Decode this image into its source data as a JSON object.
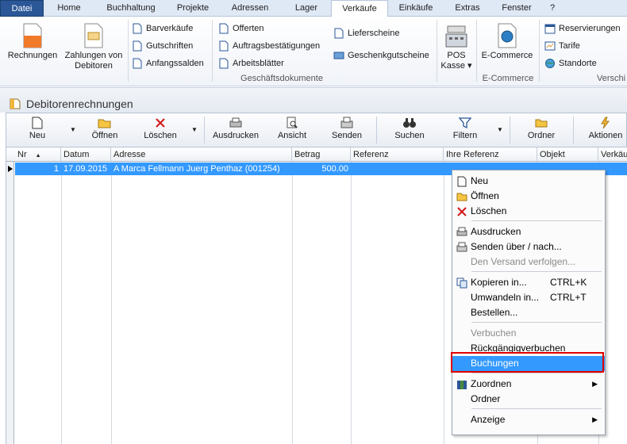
{
  "menubar": {
    "items": [
      "Datei",
      "Home",
      "Buchhaltung",
      "Projekte",
      "Adressen",
      "Lager",
      "Verkäufe",
      "Einkäufe",
      "Extras",
      "Fenster",
      "?"
    ]
  },
  "ribbon": {
    "rechnungen": "Rechnungen",
    "zahlungen_1": "Zahlungen von",
    "zahlungen_2": "Debitoren",
    "barverkaeufe": "Barverkäufe",
    "gutschriften": "Gutschriften",
    "anfangssalden": "Anfangssalden",
    "offerten": "Offerten",
    "auftragsbestaetigungen": "Auftragsbestätigungen",
    "arbeitsblaetter": "Arbeitsblätter",
    "lieferscheine": "Lieferscheine",
    "geschenkgutscheine": "Geschenkgutscheine",
    "pos_1": "POS",
    "pos_2": "Kasse ▾",
    "ecommerce": "E-Commerce",
    "reservierungen": "Reservierungen",
    "tarife": "Tarife",
    "standorte": "Standorte",
    "group_geschaeft": "Geschäftsdokumente",
    "group_ecommerce": "E-Commerce",
    "group_versch": "Verschi"
  },
  "window": {
    "title": "Debitorenrechnungen"
  },
  "toolbar": {
    "neu": "Neu",
    "oeffnen": "Öffnen",
    "loeschen": "Löschen",
    "ausdrucken": "Ausdrucken",
    "ansicht": "Ansicht",
    "senden": "Senden",
    "suchen": "Suchen",
    "filtern": "Filtern",
    "ordner": "Ordner",
    "aktionen": "Aktionen"
  },
  "grid": {
    "headers": [
      "Nr",
      "Datum",
      "Adresse",
      "Betrag",
      "Referenz",
      "Ihre Referenz",
      "Objekt",
      "Verkäu"
    ],
    "rows": [
      {
        "nr": "1",
        "datum": "17.09.2015",
        "adresse": "A Marca Fellmann Juerg Penthaz (001254)",
        "betrag": "500.00"
      }
    ]
  },
  "context_menu": {
    "neu": "Neu",
    "oeffnen": "Öffnen",
    "loeschen": "Löschen",
    "ausdrucken": "Ausdrucken",
    "senden": "Senden über / nach...",
    "versand": "Den Versand verfolgen...",
    "kopieren": "Kopieren in...",
    "kopieren_sc": "CTRL+K",
    "umwandeln": "Umwandeln in...",
    "umwandeln_sc": "CTRL+T",
    "bestellen": "Bestellen...",
    "verbuchen": "Verbuchen",
    "rueckgaengig": "Rückgängigverbuchen",
    "buchungen": "Buchungen",
    "zuordnen": "Zuordnen",
    "ordner": "Ordner",
    "anzeige": "Anzeige"
  }
}
